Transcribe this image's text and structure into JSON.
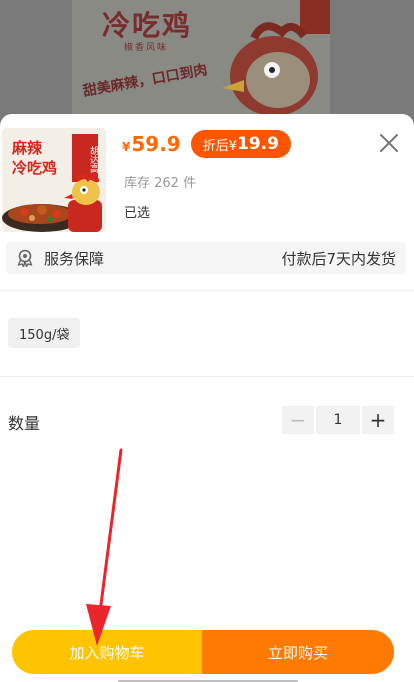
{
  "background": {
    "poster_title": "冷吃鸡",
    "poster_subtitle": "椒香风味",
    "poster_slogan": "甜美麻辣，口口到肉"
  },
  "product": {
    "thumb_title_line1": "麻辣",
    "thumb_title_line2": "冷吃鸡",
    "thumb_tag": "胡达高",
    "price_currency": "¥",
    "price_value": "59.9",
    "discount_label": "折后¥",
    "discount_value": "19.9",
    "stock_text": "库存 262 件",
    "selected_label": "已选"
  },
  "service": {
    "label": "服务保障",
    "shipping_note": "付款后7天内发货"
  },
  "spec": {
    "options": [
      "150g/袋"
    ]
  },
  "quantity": {
    "label": "数量",
    "minus": "−",
    "value": "1",
    "plus": "+"
  },
  "actions": {
    "add_to_cart": "加入购物车",
    "buy_now": "立即购买"
  },
  "colors": {
    "accent_orange": "#ff6a00",
    "badge_orange": "#ff5500",
    "cart_yellow": "#ffc300",
    "buy_orange": "#ff7a00",
    "annotation_red": "#e8262c"
  }
}
